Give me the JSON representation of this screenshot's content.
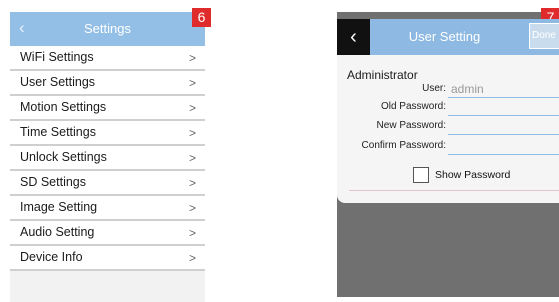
{
  "left_screen": {
    "badge": "6",
    "header": {
      "back_icon": "‹",
      "title": "Settings"
    },
    "menu_items": [
      {
        "label": "WiFi Settings",
        "chevron": ">"
      },
      {
        "label": "User Settings",
        "chevron": ">"
      },
      {
        "label": "Motion Settings",
        "chevron": ">"
      },
      {
        "label": "Time Settings",
        "chevron": ">"
      },
      {
        "label": "Unlock Settings",
        "chevron": ">"
      },
      {
        "label": "SD Settings",
        "chevron": ">"
      },
      {
        "label": "Image Setting",
        "chevron": ">"
      },
      {
        "label": "Audio Setting",
        "chevron": ">"
      },
      {
        "label": "Device Info",
        "chevron": ">"
      }
    ]
  },
  "right_screen": {
    "badge": "7",
    "header": {
      "back_icon": "‹",
      "title": "User Setting",
      "done_label": "Done"
    },
    "form": {
      "section_label": "Administrator",
      "user_label": "User:",
      "user_value": "admin",
      "old_password_label": "Old Password:",
      "new_password_label": "New Password:",
      "confirm_password_label": "Confirm Password:",
      "show_password_label": "Show Password",
      "show_password_checked": false
    }
  },
  "colors": {
    "left_header": "#93bfe6",
    "right_header": "#8db9e2",
    "badge": "#e02b2c",
    "panel_background": "#707070"
  }
}
